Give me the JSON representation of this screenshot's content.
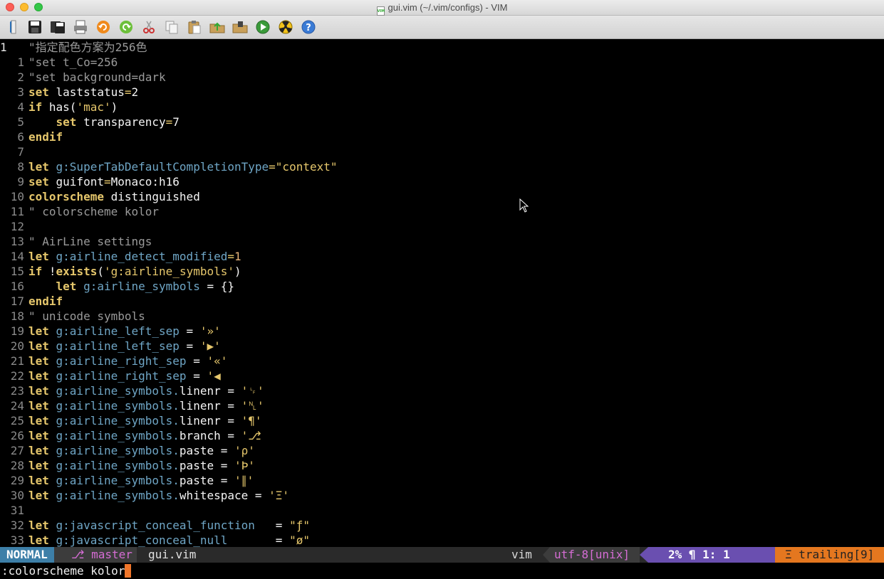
{
  "window": {
    "title": "gui.vim (~/.vim/configs) - VIM"
  },
  "toolbar": {
    "buttons": [
      {
        "icon": "open-file-icon"
      },
      {
        "icon": "save-icon"
      },
      {
        "icon": "save-all-icon"
      },
      {
        "icon": "print-icon"
      },
      {
        "icon": "undo-icon"
      },
      {
        "icon": "redo-icon"
      },
      {
        "icon": "cut-icon"
      },
      {
        "icon": "copy-icon"
      },
      {
        "icon": "paste-icon"
      },
      {
        "icon": "load-session-icon"
      },
      {
        "icon": "save-session-icon"
      },
      {
        "icon": "run-script-icon"
      },
      {
        "icon": "make-icon"
      },
      {
        "icon": "help-icon"
      }
    ]
  },
  "editor": {
    "lines": [
      {
        "n": "1",
        "parts": [
          [
            "cmt",
            "\"指定配色方案为256色"
          ]
        ]
      },
      {
        "n": "1",
        "parts": [
          [
            "cmt",
            "\"set t_Co=256"
          ]
        ]
      },
      {
        "n": "2",
        "parts": [
          [
            "cmt",
            "\"set background=dark"
          ]
        ]
      },
      {
        "n": "3",
        "parts": [
          [
            "kw",
            "set "
          ],
          [
            "ident",
            "laststatus"
          ],
          [
            "op",
            "="
          ],
          [
            "ident",
            "2"
          ]
        ]
      },
      {
        "n": "4",
        "parts": [
          [
            "kw",
            "if "
          ],
          [
            "ident",
            "has("
          ],
          [
            "str",
            "'mac'"
          ],
          [
            "ident",
            ")"
          ]
        ]
      },
      {
        "n": "5",
        "parts": [
          [
            "ident",
            "    "
          ],
          [
            "kw",
            "set "
          ],
          [
            "ident",
            "transparency"
          ],
          [
            "op",
            "="
          ],
          [
            "ident",
            "7"
          ]
        ]
      },
      {
        "n": "6",
        "parts": [
          [
            "kw",
            "endif"
          ]
        ]
      },
      {
        "n": "7",
        "parts": []
      },
      {
        "n": "8",
        "parts": [
          [
            "kw",
            "let "
          ],
          [
            "var",
            "g:SuperTabDefaultCompletionType"
          ],
          [
            "op",
            "="
          ],
          [
            "str",
            "\"context\""
          ]
        ]
      },
      {
        "n": "9",
        "parts": [
          [
            "kw",
            "set "
          ],
          [
            "ident",
            "guifont"
          ],
          [
            "op",
            "="
          ],
          [
            "ident",
            "Monaco:h16"
          ]
        ]
      },
      {
        "n": "10",
        "parts": [
          [
            "kw",
            "colorscheme "
          ],
          [
            "ident",
            "distinguished"
          ]
        ]
      },
      {
        "n": "11",
        "parts": [
          [
            "cmt",
            "\" colorscheme kolor"
          ]
        ]
      },
      {
        "n": "12",
        "parts": []
      },
      {
        "n": "13",
        "parts": [
          [
            "cmt",
            "\" AirLine settings"
          ]
        ]
      },
      {
        "n": "14",
        "parts": [
          [
            "kw",
            "let "
          ],
          [
            "var",
            "g:airline_detect_modified"
          ],
          [
            "op",
            "="
          ],
          [
            "num",
            "1"
          ]
        ]
      },
      {
        "n": "15",
        "parts": [
          [
            "kw",
            "if "
          ],
          [
            "ident",
            "!"
          ],
          [
            "kw",
            "exists"
          ],
          [
            "ident",
            "("
          ],
          [
            "str",
            "'g:airline_symbols'"
          ],
          [
            "ident",
            ")"
          ]
        ]
      },
      {
        "n": "16",
        "parts": [
          [
            "ident",
            "    "
          ],
          [
            "kw",
            "let "
          ],
          [
            "var",
            "g:airline_symbols"
          ],
          [
            "ident",
            " = {}"
          ]
        ]
      },
      {
        "n": "17",
        "parts": [
          [
            "kw",
            "endif"
          ]
        ]
      },
      {
        "n": "18",
        "parts": [
          [
            "cmt",
            "\" unicode symbols"
          ]
        ]
      },
      {
        "n": "19",
        "parts": [
          [
            "kw",
            "let "
          ],
          [
            "var",
            "g:airline_left_sep"
          ],
          [
            "ident",
            " = "
          ],
          [
            "str",
            "'»'"
          ]
        ]
      },
      {
        "n": "20",
        "parts": [
          [
            "kw",
            "let "
          ],
          [
            "var",
            "g:airline_left_sep"
          ],
          [
            "ident",
            " = "
          ],
          [
            "str",
            "'▶'"
          ]
        ]
      },
      {
        "n": "21",
        "parts": [
          [
            "kw",
            "let "
          ],
          [
            "var",
            "g:airline_right_sep"
          ],
          [
            "ident",
            " = "
          ],
          [
            "str",
            "'«'"
          ]
        ]
      },
      {
        "n": "22",
        "parts": [
          [
            "kw",
            "let "
          ],
          [
            "var",
            "g:airline_right_sep"
          ],
          [
            "ident",
            " = "
          ],
          [
            "str",
            "'◀"
          ]
        ]
      },
      {
        "n": "23",
        "parts": [
          [
            "kw",
            "let "
          ],
          [
            "var",
            "g:airline_symbols."
          ],
          [
            "ident",
            "linenr"
          ],
          [
            "ident",
            " = "
          ],
          [
            "str",
            "'␊'"
          ]
        ]
      },
      {
        "n": "24",
        "parts": [
          [
            "kw",
            "let "
          ],
          [
            "var",
            "g:airline_symbols."
          ],
          [
            "ident",
            "linenr"
          ],
          [
            "ident",
            " = "
          ],
          [
            "str",
            "'␤'"
          ]
        ]
      },
      {
        "n": "25",
        "parts": [
          [
            "kw",
            "let "
          ],
          [
            "var",
            "g:airline_symbols."
          ],
          [
            "ident",
            "linenr"
          ],
          [
            "ident",
            " = "
          ],
          [
            "str",
            "'¶'"
          ]
        ]
      },
      {
        "n": "26",
        "parts": [
          [
            "kw",
            "let "
          ],
          [
            "var",
            "g:airline_symbols."
          ],
          [
            "ident",
            "branch"
          ],
          [
            "ident",
            " = "
          ],
          [
            "str",
            "'⎇"
          ]
        ]
      },
      {
        "n": "27",
        "parts": [
          [
            "kw",
            "let "
          ],
          [
            "var",
            "g:airline_symbols."
          ],
          [
            "ident",
            "paste"
          ],
          [
            "ident",
            " = "
          ],
          [
            "str",
            "'ρ'"
          ]
        ]
      },
      {
        "n": "28",
        "parts": [
          [
            "kw",
            "let "
          ],
          [
            "var",
            "g:airline_symbols."
          ],
          [
            "ident",
            "paste"
          ],
          [
            "ident",
            " = "
          ],
          [
            "str",
            "'Þ'"
          ]
        ]
      },
      {
        "n": "29",
        "parts": [
          [
            "kw",
            "let "
          ],
          [
            "var",
            "g:airline_symbols."
          ],
          [
            "ident",
            "paste"
          ],
          [
            "ident",
            " = "
          ],
          [
            "str",
            "'∥'"
          ]
        ]
      },
      {
        "n": "30",
        "parts": [
          [
            "kw",
            "let "
          ],
          [
            "var",
            "g:airline_symbols."
          ],
          [
            "ident",
            "whitespace"
          ],
          [
            "ident",
            " = "
          ],
          [
            "str",
            "'Ξ'"
          ]
        ]
      },
      {
        "n": "31",
        "parts": []
      },
      {
        "n": "32",
        "parts": [
          [
            "kw",
            "let "
          ],
          [
            "var",
            "g:javascript_conceal_function"
          ],
          [
            "ident",
            "   = "
          ],
          [
            "str",
            "\"ƒ\""
          ]
        ]
      },
      {
        "n": "33",
        "parts": [
          [
            "kw",
            "let "
          ],
          [
            "var",
            "g:javascript_conceal_null"
          ],
          [
            "ident",
            "       = "
          ],
          [
            "str",
            "\"ø\""
          ]
        ]
      }
    ]
  },
  "statusline": {
    "mode": "NORMAL",
    "branch": "⎇ master",
    "file": "gui.vim",
    "filetype": "vim",
    "encoding": "utf-8[unix]",
    "position": "2% ¶   1:  1",
    "warning": "Ξ trailing[9]",
    "colors": {
      "mode_bg": "#3d7fa8",
      "branch_fg": "#d56dd4",
      "pos_bg": "#6a4fb0",
      "warn_bg": "#e4771f"
    }
  },
  "cmdline": {
    "text": ":colorscheme kolor"
  }
}
